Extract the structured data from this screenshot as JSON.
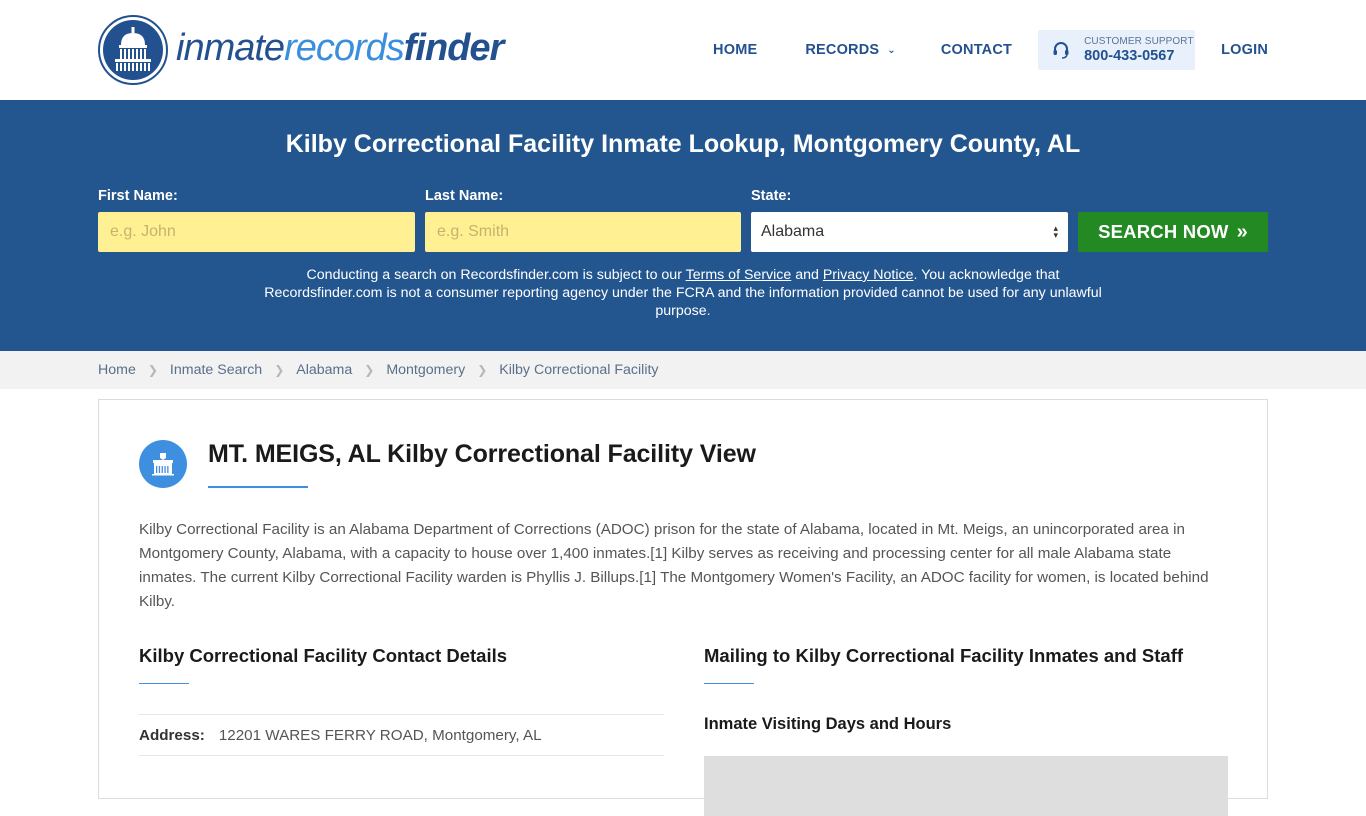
{
  "logo": {
    "part1": "inmate",
    "part2": "records",
    "part3": "finder",
    "icon": "capitol-dome-icon"
  },
  "nav": {
    "home": "HOME",
    "records": "RECORDS",
    "contact": "CONTACT",
    "support_label": "CUSTOMER SUPPORT",
    "support_phone": "800-433-0567",
    "login": "LOGIN"
  },
  "hero": {
    "title": "Kilby Correctional Facility Inmate Lookup, Montgomery County, AL",
    "first_name_label": "First Name:",
    "first_name_placeholder": "e.g. John",
    "first_name_value": "",
    "last_name_label": "Last Name:",
    "last_name_placeholder": "e.g. Smith",
    "last_name_value": "",
    "state_label": "State:",
    "state_value": "Alabama",
    "search_button": "SEARCH NOW",
    "disclaimer_pre": "Conducting a search on Recordsfinder.com is subject to our ",
    "terms_link": "Terms of Service",
    "disclaimer_and": " and ",
    "privacy_link": "Privacy Notice",
    "disclaimer_post": ". You acknowledge that Recordsfinder.com is not a consumer reporting agency under the FCRA and the information provided cannot be used for any unlawful purpose."
  },
  "breadcrumb": [
    "Home",
    "Inmate Search",
    "Alabama",
    "Montgomery",
    "Kilby Correctional Facility"
  ],
  "main": {
    "title": "MT. MEIGS, AL Kilby Correctional Facility View",
    "intro": "Kilby Correctional Facility is an Alabama Department of Corrections (ADOC) prison for the state of Alabama, located in Mt. Meigs, an unincorporated area in Montgomery County, Alabama, with a capacity to house over 1,400 inmates.[1] Kilby serves as receiving and processing center for all male Alabama state inmates. The current Kilby Correctional Facility warden is Phyllis J. Billups.[1] The Montgomery Women's Facility, an ADOC facility for women, is located behind Kilby.",
    "contact_title": "Kilby Correctional Facility Contact Details",
    "address_label": "Address:",
    "address_value": "12201 WARES FERRY ROAD, Montgomery, AL",
    "mailing_title": "Mailing to Kilby Correctional Facility Inmates and Staff",
    "visiting_title": "Inmate Visiting Days and Hours"
  },
  "colors": {
    "brand_blue": "#23568f",
    "accent_blue": "#3f8fe1",
    "search_green": "#238a23",
    "input_yellow": "#fef093"
  }
}
